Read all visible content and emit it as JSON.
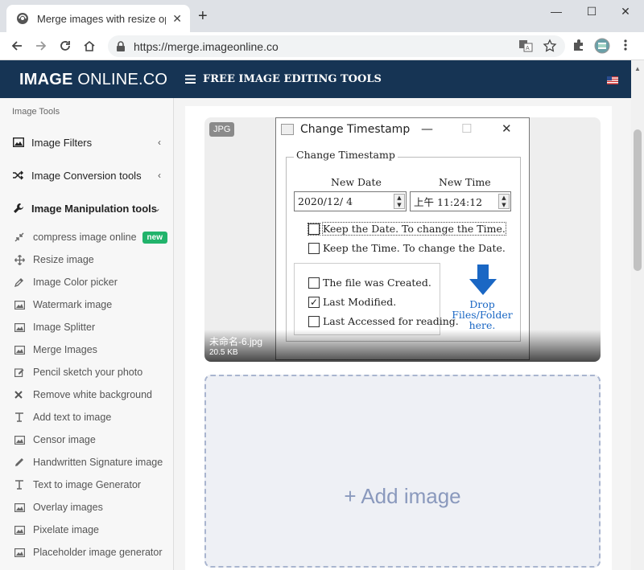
{
  "browser": {
    "tab_title": "Merge images with resize optio",
    "url": "https://merge.imageonline.co",
    "minimize": "—",
    "maximize": "☐",
    "close": "✕"
  },
  "site": {
    "logo_bold": "IMAGE",
    "logo_rest": " ONLINE.CO",
    "menu_label": "FREE IMAGE EDITING TOOLS"
  },
  "sidebar": {
    "heading": "Image Tools",
    "sections": [
      {
        "label": "Image Filters",
        "icon": "image-icon",
        "chevron": "‹"
      },
      {
        "label": "Image Conversion tools",
        "icon": "shuffle-icon",
        "chevron": "‹"
      },
      {
        "label": "Image Manipulation tools",
        "icon": "wrench-icon",
        "chevron": "⌄"
      }
    ],
    "items": [
      {
        "label": "compress image online",
        "icon": "compress-icon",
        "badge": "new"
      },
      {
        "label": "Resize image",
        "icon": "move-icon"
      },
      {
        "label": "Image Color picker",
        "icon": "eyedropper-icon"
      },
      {
        "label": "Watermark image",
        "icon": "image-icon"
      },
      {
        "label": "Image Splitter",
        "icon": "image-icon"
      },
      {
        "label": "Merge Images",
        "icon": "image-icon"
      },
      {
        "label": "Pencil sketch your photo",
        "icon": "edit-icon"
      },
      {
        "label": "Remove white background",
        "icon": "x-icon"
      },
      {
        "label": "Add text to image",
        "icon": "text-icon"
      },
      {
        "label": "Censor image",
        "icon": "image-icon"
      },
      {
        "label": "Handwritten Signature image",
        "icon": "pencil-icon"
      },
      {
        "label": "Text to image Generator",
        "icon": "text-icon"
      },
      {
        "label": "Overlay images",
        "icon": "image-icon"
      },
      {
        "label": "Pixelate image",
        "icon": "image-icon"
      },
      {
        "label": "Placeholder image generator",
        "icon": "image-icon"
      }
    ]
  },
  "upload": {
    "type_badge": "JPG",
    "file_name": "未命名-6.jpg",
    "file_size": "20.5 KB",
    "add_label": "+ Add image"
  },
  "dialog": {
    "title": "Change Timestamp",
    "group_label": "Change Timestamp",
    "date_label": "New Date",
    "time_label": "New Time",
    "date_value": "2020/12/ 4",
    "time_value": "上午 11:24:12",
    "keep_date": "Keep the Date. To change the Time.",
    "keep_time": "Keep the Time. To change the Date.",
    "created": "The file was Created.",
    "modified": "Last Modified.",
    "accessed": "Last Accessed for reading.",
    "drop_text": "Drop Files/Folder here.",
    "modified_checked": true
  }
}
